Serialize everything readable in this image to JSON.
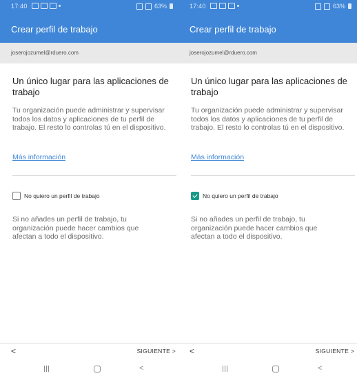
{
  "screens": [
    {
      "status": {
        "time": "17:40",
        "battery": "63%"
      },
      "appbar_title": "Crear perfil de trabajo",
      "account_email": "joserojozumel@rduero.com",
      "heading": "Un único lugar para las aplicaciones de trabajo",
      "body": "Tu organización puede administrar y supervisar todos los datos y aplicaciones de tu perfil de trabajo. El resto lo controlas tú en el dispositivo.",
      "learn_more": "Más información",
      "checkbox_label": "No quiero un perfil de trabajo",
      "checkbox_checked": false,
      "note": "Si no añades un perfil de trabajo, tu organización puede hacer cambios que afectan a todo el dispositivo.",
      "back_label": "<",
      "next_label": "SIGUIENTE >"
    },
    {
      "status": {
        "time": "17:40",
        "battery": "63%"
      },
      "appbar_title": "Crear perfil de trabajo",
      "account_email": "joserojozumel@rduero.com",
      "heading": "Un único lugar para las aplicaciones de trabajo",
      "body": "Tu organización puede administrar y supervisar todos los datos y aplicaciones de tu perfil de trabajo. El resto lo controlas tú en el dispositivo.",
      "learn_more": "Más información",
      "checkbox_label": "No quiero un perfil de trabajo",
      "checkbox_checked": true,
      "note": "Si no añades un perfil de trabajo, tu organización puede hacer cambios que afectan a todo el dispositivo.",
      "back_label": "<",
      "next_label": "SIGUIENTE >"
    }
  ],
  "navbar": {
    "back_glyph": "<"
  },
  "colors": {
    "primary": "#3f86d8",
    "checkbox_checked": "#1a9b8a",
    "account_bg": "#e9e9e9"
  }
}
